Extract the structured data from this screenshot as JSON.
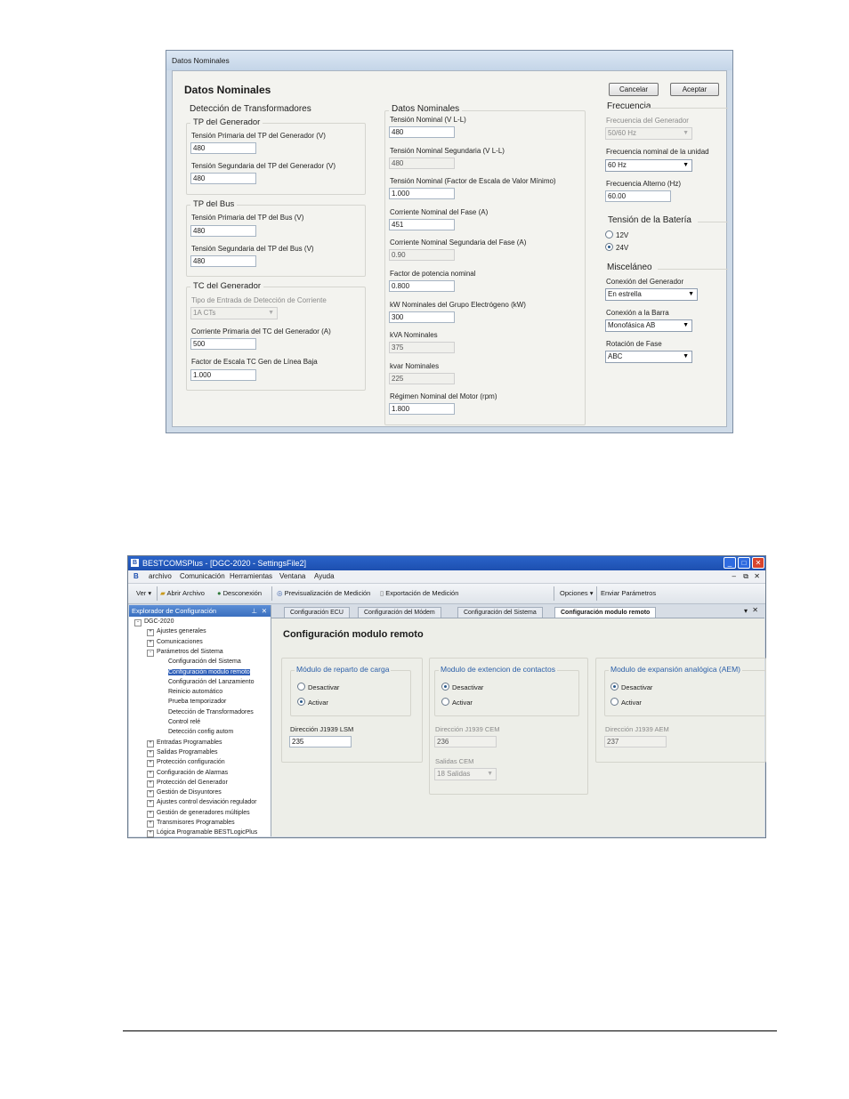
{
  "window1": {
    "title": "Datos Nominales",
    "heading": "Datos Nominales",
    "cancel_label": "Cancelar",
    "accept_label": "Aceptar",
    "transformers": {
      "title": "Detección de Transformadores",
      "tp_gen": {
        "title": "TP del Generador",
        "primary_label": "Tensión Primaria del TP del Generador (V)",
        "primary_value": "480",
        "secondary_label": "Tensión Segundaria del TP del Generador (V)",
        "secondary_value": "480"
      },
      "tp_bus": {
        "title": "TP del Bus",
        "primary_label": "Tensión Primaria del TP del Bus (V)",
        "primary_value": "480",
        "secondary_label": "Tensión Segundaria del TP del Bus (V)",
        "secondary_value": "480"
      },
      "tc_gen": {
        "title": "TC del Generador",
        "type_label": "Tipo de Entrada de Detección de Corriente",
        "type_value": "1A CTs",
        "primary_label": "Corriente Primaria del TC del Generador (A)",
        "primary_value": "500",
        "scale_label": "Factor de Escala TC Gen de Línea Baja",
        "scale_value": "1.000"
      }
    },
    "nominal": {
      "title": "Datos Nominales",
      "fields": [
        {
          "label": "Tensión Nominal (V L-L)",
          "value": "480",
          "disabled": false
        },
        {
          "label": "Tensión Nominal Segundaria (V L-L)",
          "value": "480",
          "disabled": true
        },
        {
          "label": "Tensión Nominal (Factor de Escala de Valor Mínimo)",
          "value": "1.000",
          "disabled": false
        },
        {
          "label": "Corriente Nominal del Fase (A)",
          "value": "451",
          "disabled": false
        },
        {
          "label": "Corriente Nominal Segundaria del Fase (A)",
          "value": "0.90",
          "disabled": true
        },
        {
          "label": "Factor de potencia nominal",
          "value": "0.800",
          "disabled": false
        },
        {
          "label": "kW Nominales del Grupo Electrógeno (kW)",
          "value": "300",
          "disabled": false
        },
        {
          "label": "kVA Nominales",
          "value": "375",
          "disabled": true
        },
        {
          "label": "kvar Nominales",
          "value": "225",
          "disabled": true
        },
        {
          "label": "Régimen Nominal del Motor (rpm)",
          "value": "1.800",
          "disabled": false
        }
      ]
    },
    "frequency": {
      "title": "Frecuencia",
      "gen_label": "Frecuencia del Generador",
      "gen_value": "50/60 Hz",
      "unit_label": "Frecuencia nominal de la unidad",
      "unit_value": "60 Hz",
      "alt_label": "Frecuencia Alterno (Hz)",
      "alt_value": "60.00"
    },
    "battery": {
      "title": "Tensión de la Batería",
      "opt1": "12V",
      "opt2": "24V"
    },
    "misc": {
      "title": "Misceláneo",
      "gen_conn_label": "Conexión del Generador",
      "gen_conn_value": "En estrella",
      "bus_conn_label": "Conexión a la Barra",
      "bus_conn_value": "Monofásica AB",
      "rotation_label": "Rotación de Fase",
      "rotation_value": "ABC"
    }
  },
  "window2": {
    "title": "BESTCOMSPlus - [DGC-2020 - SettingsFile2]",
    "menu": [
      "archivo",
      "Comunicación",
      "Herramientas",
      "Ventana",
      "Ayuda"
    ],
    "toolbar": {
      "view": "Ver",
      "open_file": "Abrir Archivo",
      "disconnect": "Desconexión",
      "preview": "Previsualización de Medición",
      "export": "Exportación de Medición",
      "options": "Opciones",
      "send": "Enviar Parámetros"
    },
    "explorer": {
      "title": "Explorador de Configuración",
      "root": "DGC-2020",
      "items": [
        {
          "label": "Ajustes generales",
          "expand": "+"
        },
        {
          "label": "Comunicaciones",
          "expand": "+"
        },
        {
          "label": "Parámetros del Sistema",
          "expand": "-"
        }
      ],
      "sub_items": [
        "Configuración del Sistema",
        "Configuración modulo remoto",
        "Configuración del Lanzamiento",
        "Reinicio automático",
        "Prueba temporizador",
        "Detección de Transformadores",
        "Control relé",
        "Detección config autom"
      ],
      "rest_items": [
        "Entradas Programables",
        "Salidas Programables",
        "Protección configuración",
        "Configuración de Alarmas",
        "Protección del Generador",
        "Gestión de Disyuntores",
        "Ajustes control desviación regulador",
        "Gestión de generadores múltiples",
        "Transmisores Programables",
        "Lógica Programable BESTLogicPlus"
      ]
    },
    "tabs": [
      "Configuración ECU",
      "Configuración del Módem",
      "Configuración del Sistema",
      "Configuración modulo remoto"
    ],
    "panel": {
      "heading": "Configuración modulo remoto",
      "lsm": {
        "title": "Módulo de reparto de carga",
        "opt_off": "Desactivar",
        "opt_on": "Activar",
        "addr_label": "Dirección J1939 LSM",
        "addr_value": "235"
      },
      "cem": {
        "title": "Modulo de extencion de contactos",
        "opt_off": "Desactivar",
        "opt_on": "Activar",
        "addr_label": "Dirección J1939 CEM",
        "addr_value": "236",
        "outputs_label": "Salidas CEM",
        "outputs_value": "18 Salidas"
      },
      "aem": {
        "title": "Modulo de expansión analógica (AEM)",
        "opt_off": "Desactivar",
        "opt_on": "Activar",
        "addr_label": "Dirección J1939 AEM",
        "addr_value": "237"
      }
    }
  }
}
